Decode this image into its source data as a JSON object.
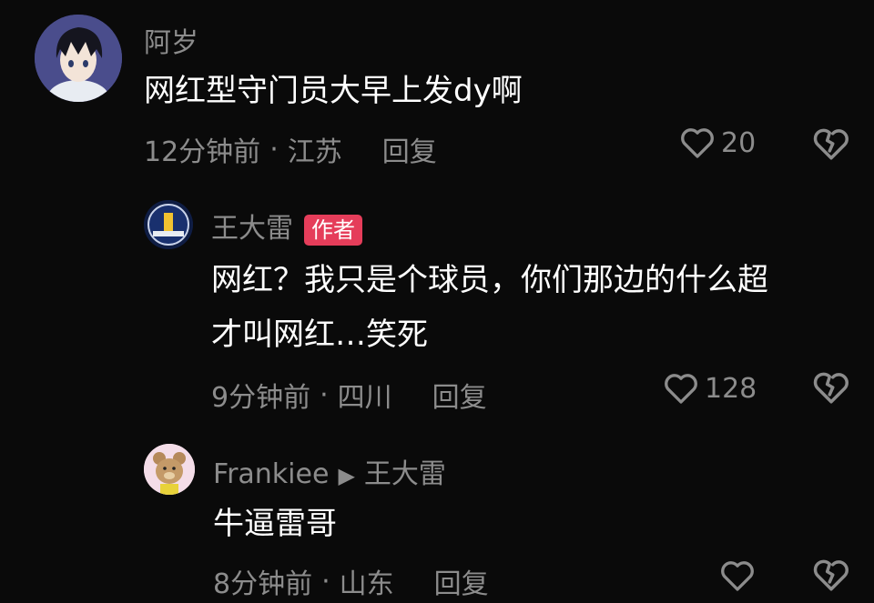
{
  "comments": [
    {
      "username": "阿岁",
      "text": "网红型守门员大早上发dy啊",
      "time": "12分钟前",
      "location": "江苏",
      "reply_label": "回复",
      "likes": "20",
      "avatar_icon": "anime-boy-avatar"
    },
    {
      "username": "王大雷",
      "badge": "作者",
      "text_line1": "网红？我只是个球员，你们那边的什么超",
      "text_line2": "才叫网红…笑死",
      "time": "9分钟前",
      "location": "四川",
      "reply_label": "回复",
      "likes": "128",
      "avatar_icon": "team-logo-avatar"
    },
    {
      "username": "Frankiee",
      "reply_to": "王大雷",
      "text": "牛逼雷哥",
      "time": "8分钟前",
      "location": "山东",
      "reply_label": "回复",
      "avatar_icon": "bear-avatar"
    }
  ],
  "colors": {
    "background": "#0a0a0a",
    "muted": "#8c8c8c",
    "badge": "#e53d5a"
  }
}
